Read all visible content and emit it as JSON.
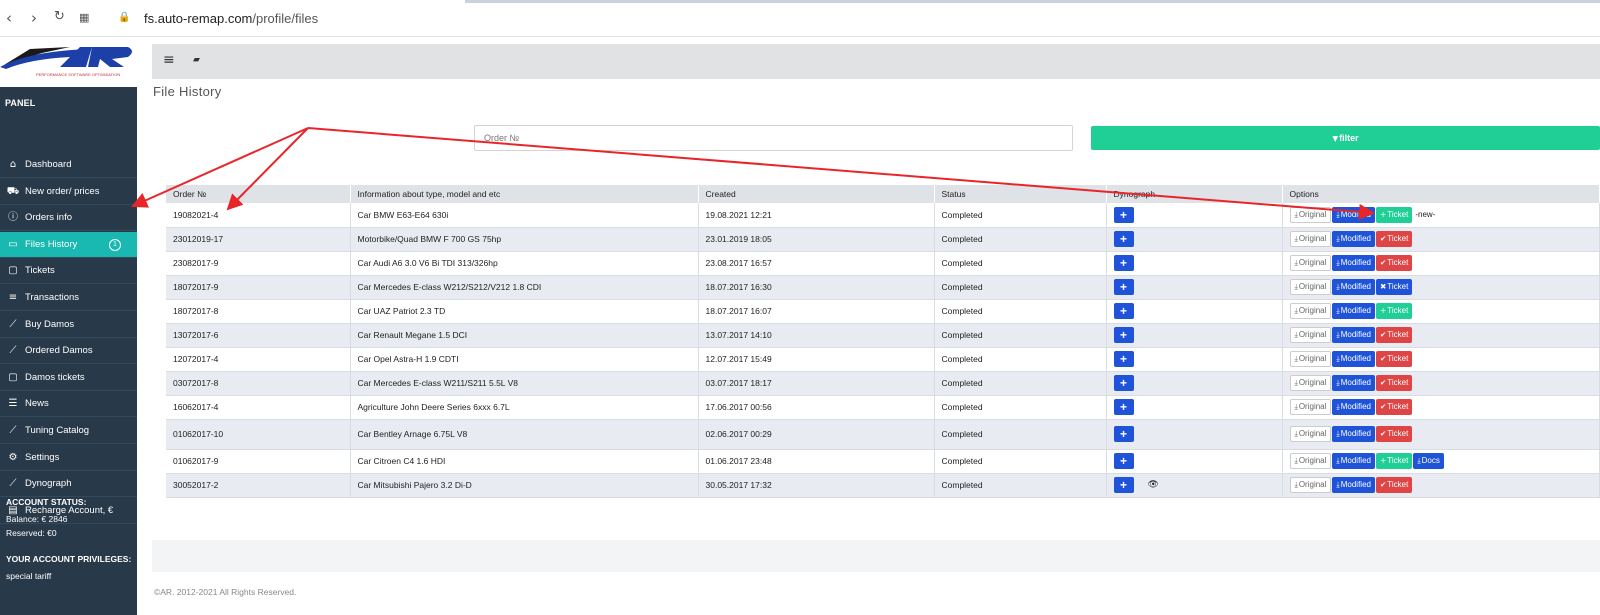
{
  "browser": {
    "url_host": "fs.auto-remap.com",
    "url_path": "/profile/files"
  },
  "sidebar": {
    "logo_tagline": "PERFORMANCE SOFTWARE OPTIMISATION",
    "section_panel": "PANEL",
    "items": [
      {
        "label": "Dashboard",
        "icon": "home-icon"
      },
      {
        "label": "New order/ prices",
        "icon": "cart-icon"
      },
      {
        "label": "Orders info",
        "icon": "info-icon"
      },
      {
        "label": "Files History",
        "icon": "folder-icon",
        "badge": "1",
        "active": true
      },
      {
        "label": "Tickets",
        "icon": "chat-icon"
      },
      {
        "label": "Transactions",
        "icon": "money-icon"
      },
      {
        "label": "Buy Damos",
        "icon": "chart-icon"
      },
      {
        "label": "Ordered Damos",
        "icon": "chart-icon"
      },
      {
        "label": "Damos tickets",
        "icon": "chat-icon"
      },
      {
        "label": "News",
        "icon": "list-icon"
      },
      {
        "label": "Tuning Catalog",
        "icon": "chart-icon"
      },
      {
        "label": "Settings",
        "icon": "gear-icon"
      },
      {
        "label": "Dynograph",
        "icon": "chart-icon"
      },
      {
        "label": "Recharge Account, €",
        "icon": "wallet-icon"
      }
    ],
    "account_status_title": "ACCOUNT STATUS:",
    "balance": "Balance: € 2846",
    "reserved": "Reserved: €0",
    "privileges_title": "YOUR ACCOUNT PRIVILEGES:",
    "privilege": "special tariff"
  },
  "page": {
    "title": "File History",
    "order_placeholder": "Order №",
    "filter_label": "filter"
  },
  "table": {
    "headers": [
      "Order №",
      "Information about type, model and etc",
      "Created",
      "Status",
      "Dynograph",
      "Options"
    ],
    "rows": [
      {
        "order": "19082021-4",
        "info": "Car BMW E63-E64 630i",
        "created": "19.08.2021 12:21",
        "status": "Completed",
        "ticket": "Ticket",
        "ticket_style": "green",
        "extra": "-new-"
      },
      {
        "order": "23012019-17",
        "info": "Motorbike/Quad BMW F 700 GS 75hp",
        "created": "23.01.2019 18:05",
        "status": "Completed",
        "ticket": "Ticket",
        "ticket_style": "red"
      },
      {
        "order": "23082017-9",
        "info": "Car Audi A6 3.0 V6 Bi TDI 313/326hp",
        "created": "23.08.2017 16:57",
        "status": "Completed",
        "ticket": "Ticket",
        "ticket_style": "red"
      },
      {
        "order": "18072017-9",
        "info": "Car Mercedes E-class W212/S212/V212 1.8 CDI",
        "created": "18.07.2017 16:30",
        "status": "Completed",
        "ticket": "Ticket",
        "ticket_style": "blue"
      },
      {
        "order": "18072017-8",
        "info": "Car UAZ Patriot 2.3 TD",
        "created": "18.07.2017 16:07",
        "status": "Completed",
        "ticket": "Ticket",
        "ticket_style": "green"
      },
      {
        "order": "13072017-6",
        "info": "Car Renault Megane 1.5 DCI",
        "created": "13.07.2017 14:10",
        "status": "Completed",
        "ticket": "Ticket",
        "ticket_style": "red"
      },
      {
        "order": "12072017-4",
        "info": "Car Opel Astra-H 1.9 CDTI",
        "created": "12.07.2017 15:49",
        "status": "Completed",
        "ticket": "Ticket",
        "ticket_style": "red"
      },
      {
        "order": "03072017-8",
        "info": "Car Mercedes E-class W211/S211 5.5L V8",
        "created": "03.07.2017 18:17",
        "status": "Completed",
        "ticket": "Ticket",
        "ticket_style": "red"
      },
      {
        "order": "16062017-4",
        "info": "Agriculture John Deere Series 6xxx 6.7L",
        "created": "17.06.2017 00:56",
        "status": "Completed",
        "ticket": "Ticket",
        "ticket_style": "red"
      },
      {
        "order": "01062017-10",
        "info": "Car Bentley Arnage 6.75L V8",
        "created": "02.06.2017 00:29",
        "status": "Completed",
        "ticket": "Ticket",
        "ticket_style": "red",
        "tall": true
      },
      {
        "order": "01062017-9",
        "info": "Car Citroen C4 1.6 HDI",
        "created": "01.06.2017 23:48",
        "status": "Completed",
        "ticket": "Ticket",
        "ticket_style": "green",
        "docs": "Docs"
      },
      {
        "order": "30052017-2",
        "info": "Car Mitsubishi Pajero 3.2 Di-D",
        "created": "30.05.2017 17:32",
        "status": "Completed",
        "ticket": "Ticket",
        "ticket_style": "red",
        "eye": true
      }
    ],
    "original_label": "Original",
    "modified_label": "Modified",
    "dyno_label": "+"
  },
  "footer": {
    "copyright": "©AR. 2012-2021 All Rights Reserved."
  },
  "colors": {
    "sidebar_bg": "#283949",
    "accent_active": "#19b8b0",
    "filter_green": "#1fcf95",
    "primary_blue": "#1f53d8",
    "danger_red": "#e04545",
    "annotation_red": "#e8262a"
  }
}
